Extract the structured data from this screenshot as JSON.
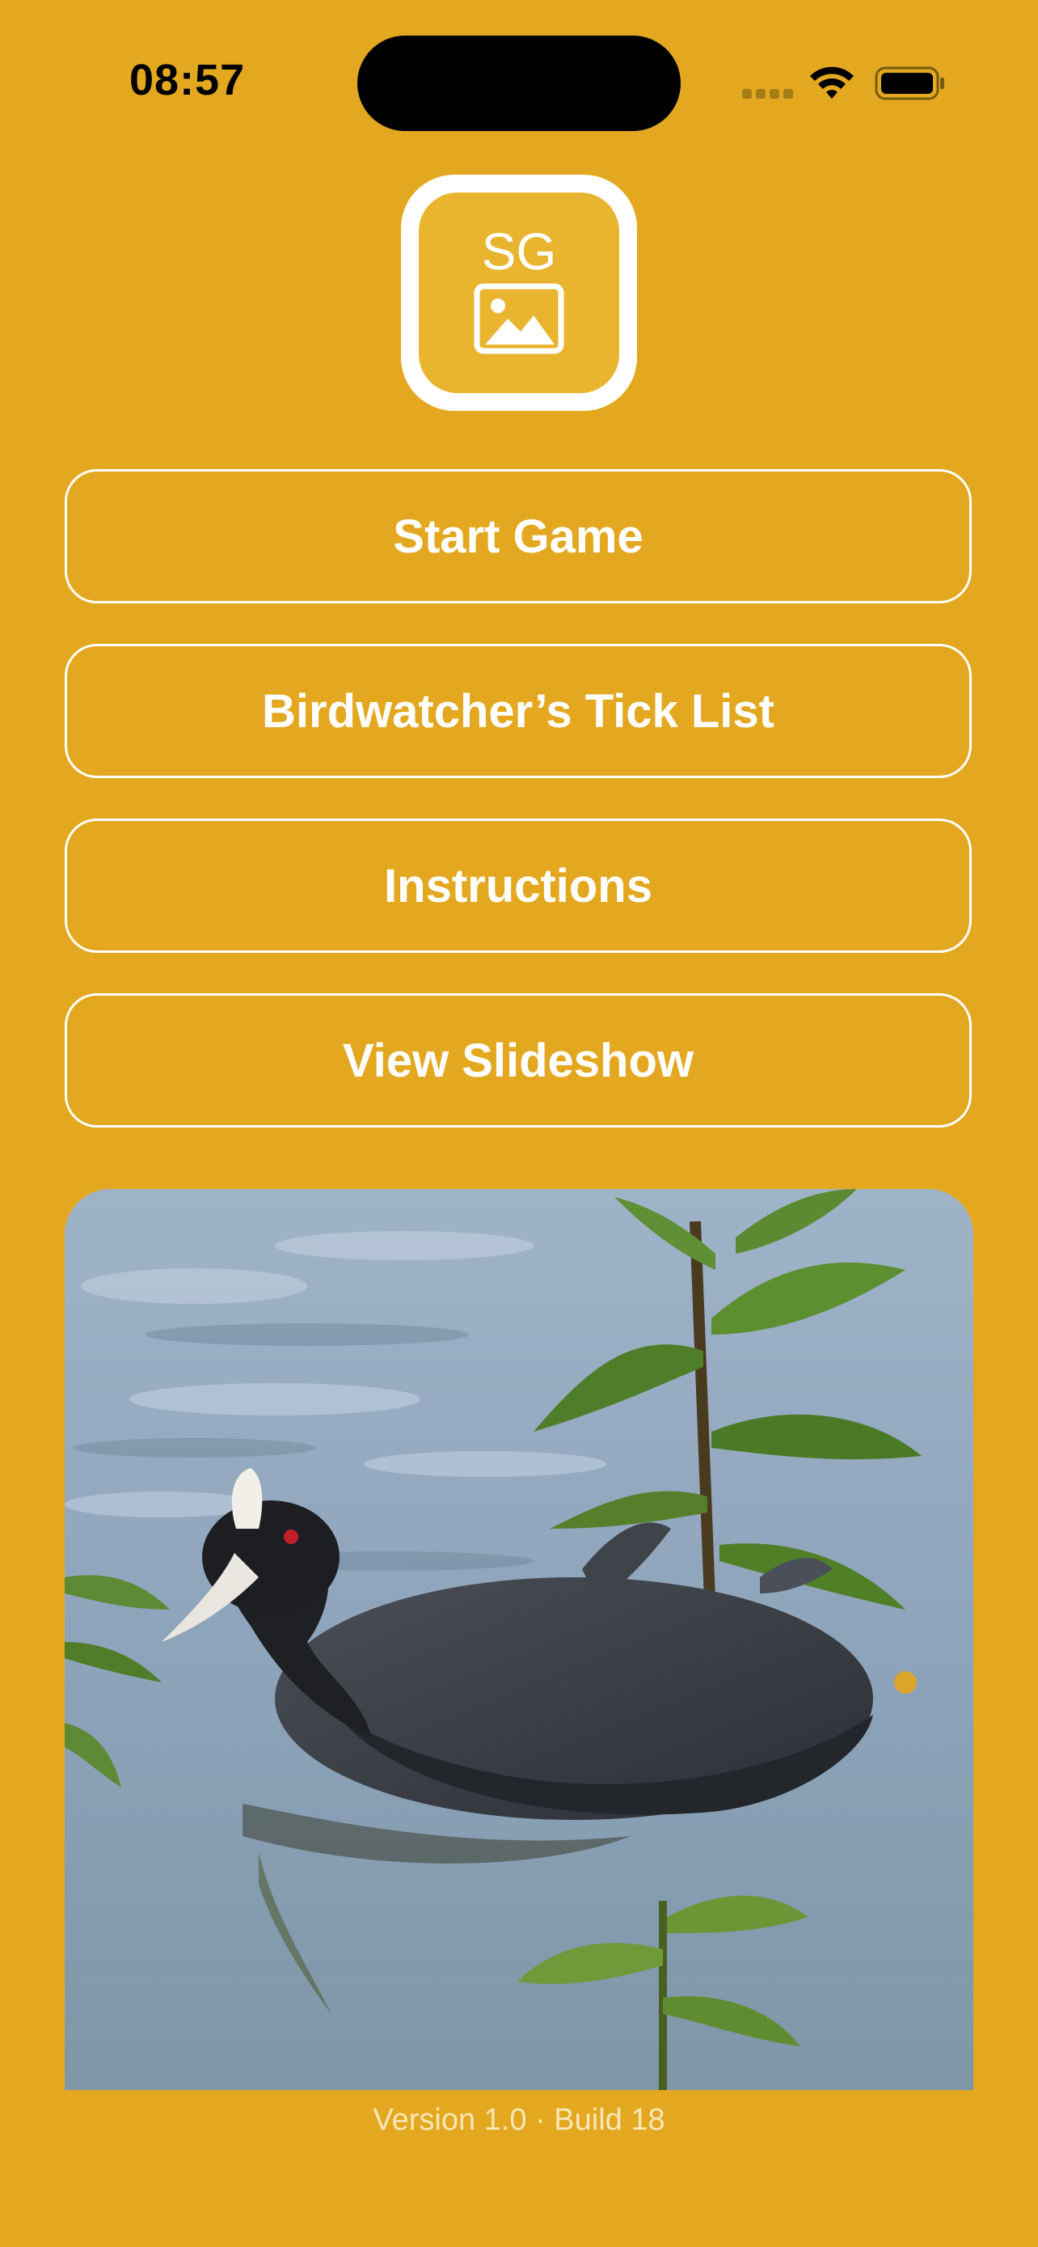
{
  "status_bar": {
    "time": "08:57",
    "icons": [
      "cellular-signal-icon",
      "wifi-icon",
      "battery-icon"
    ]
  },
  "app_logo": {
    "text": "SG",
    "icon": "picture-icon"
  },
  "menu": {
    "start_game": "Start Game",
    "tick_list": "Birdwatcher’s Tick List",
    "instructions": "Instructions",
    "slideshow": "View Slideshow"
  },
  "photo": {
    "subject": "bird-photo"
  },
  "footer": {
    "version": "Version 1.0 · Build 18"
  },
  "colors": {
    "background": "#E3A81F",
    "button_border": "#FFFFFF",
    "text": "#FFFFFF"
  }
}
